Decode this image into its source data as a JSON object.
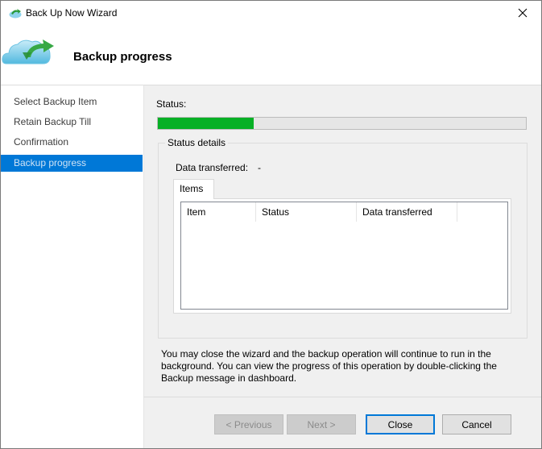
{
  "window": {
    "title": "Back Up Now Wizard"
  },
  "header": {
    "heading": "Backup progress"
  },
  "nav": {
    "items": [
      {
        "label": "Select Backup Item",
        "active": false
      },
      {
        "label": "Retain Backup Till",
        "active": false
      },
      {
        "label": "Confirmation",
        "active": false
      },
      {
        "label": "Backup progress",
        "active": true
      }
    ]
  },
  "status": {
    "label": "Status:",
    "progress_percent": 26
  },
  "details": {
    "group_title": "Status details",
    "data_transferred_label": "Data transferred:",
    "data_transferred_value": "-",
    "tab_label": "Items",
    "columns": [
      "Item",
      "Status",
      "Data transferred"
    ]
  },
  "info_text": "You may close the wizard and the backup operation will continue to run in the background. You can view the progress of this operation by double-clicking the Backup message in dashboard.",
  "buttons": {
    "previous": "< Previous",
    "next": "Next >",
    "close": "Close",
    "cancel": "Cancel"
  },
  "icons": {
    "app": "backup-cloud-icon",
    "close": "close-icon",
    "hero": "cloud-restore-icon"
  },
  "colors": {
    "accent": "#0078d7",
    "progress_fill": "#06b025"
  }
}
